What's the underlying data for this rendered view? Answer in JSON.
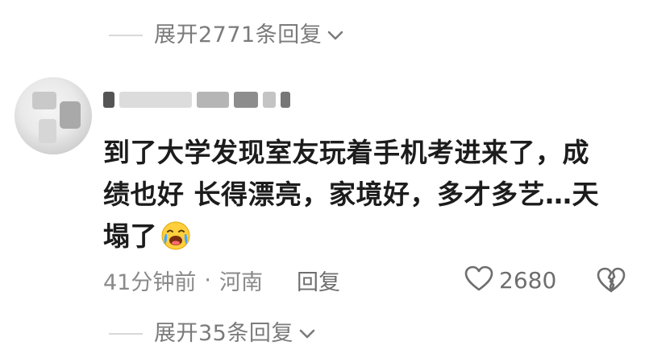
{
  "top_expand": {
    "label": "展开2771条回复"
  },
  "comment": {
    "line1": "到了大学发现室友玩着手机考进来了，成",
    "line2": "绩也好 长得漂亮，家境好，多才多艺…天",
    "line3": "塌了",
    "emoji": "crying-laughing-emoji"
  },
  "meta": {
    "time": "41分钟前",
    "separator": "·",
    "location": "河南",
    "reply_label": "回复",
    "like_count": "2680"
  },
  "bottom_expand": {
    "label": "展开35条回复"
  },
  "icons": [
    "chevron-down-icon",
    "heart-icon",
    "broken-heart-icon"
  ]
}
